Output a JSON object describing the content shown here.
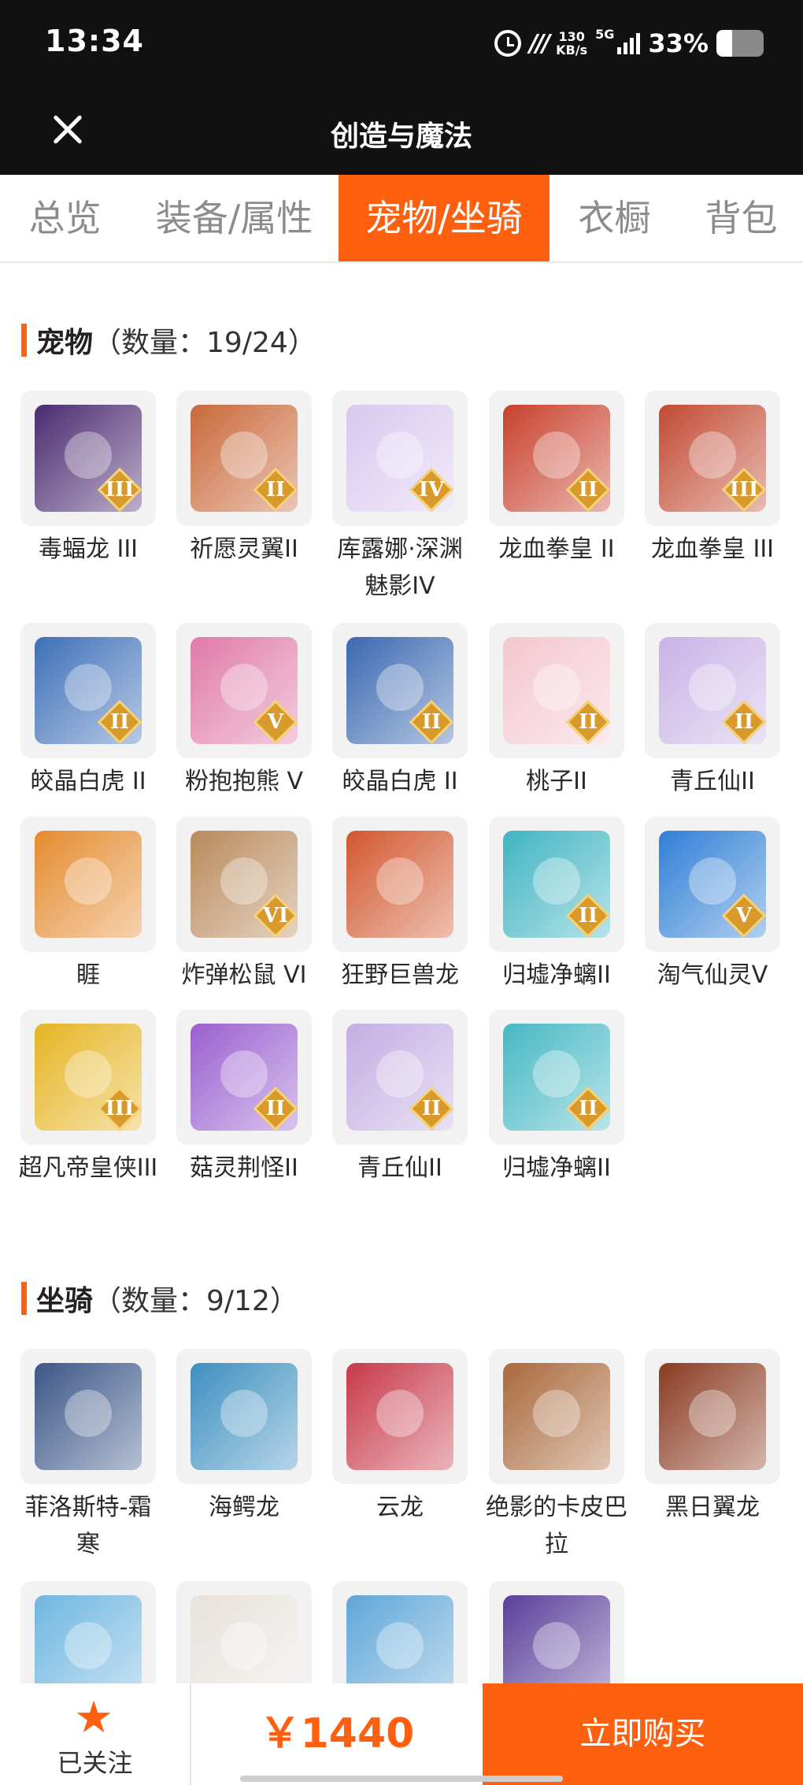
{
  "status_bar": {
    "time": "13:34",
    "network_speed_value": "130",
    "network_speed_unit": "KB/s",
    "network_type": "5G",
    "battery_percent": "33%",
    "battery_level": 0.33,
    "signal_bars": 4,
    "icons": [
      "alarm-icon",
      "mi-icon",
      "signal-icon",
      "battery-icon"
    ]
  },
  "nav": {
    "title": "创造与魔法",
    "close_icon": "close-icon"
  },
  "tabs": [
    {
      "label": "总览",
      "active": false
    },
    {
      "label": "装备/属性",
      "active": false
    },
    {
      "label": "宠物/坐骑",
      "active": true
    },
    {
      "label": "衣橱",
      "active": false
    },
    {
      "label": "背包",
      "active": false
    }
  ],
  "pets": {
    "title": "宠物",
    "count_label": "（数量：19/24）",
    "items": [
      {
        "name": "毒蝠龙 III",
        "tier": "III",
        "art": "#4b2a70"
      },
      {
        "name": "祈愿灵翼II",
        "tier": "II",
        "art": "#c9683a"
      },
      {
        "name": "库露娜·深渊魅影IV",
        "tier": "IV",
        "art": "#d9c8f0"
      },
      {
        "name": "龙血拳皇 II",
        "tier": "II",
        "art": "#c8402c"
      },
      {
        "name": "龙血拳皇 III",
        "tier": "III",
        "art": "#c24a33"
      },
      {
        "name": "皎晶白虎 II",
        "tier": "II",
        "art": "#3d6fb8"
      },
      {
        "name": "粉抱抱熊 V",
        "tier": "V",
        "art": "#e07aa8"
      },
      {
        "name": "皎晶白虎 II",
        "tier": "II",
        "art": "#3a68b0"
      },
      {
        "name": "桃子II",
        "tier": "II",
        "art": "#f4c6cf"
      },
      {
        "name": "青丘仙II",
        "tier": "II",
        "art": "#c9b3e6"
      },
      {
        "name": "睚",
        "tier": "",
        "art": "#e58a2e"
      },
      {
        "name": "炸弹松鼠 VI",
        "tier": "VI",
        "art": "#b98a5c"
      },
      {
        "name": "狂野巨兽龙",
        "tier": "",
        "art": "#d2572e"
      },
      {
        "name": "归墟净螭II",
        "tier": "II",
        "art": "#3fb4c2"
      },
      {
        "name": "淘气仙灵V",
        "tier": "V",
        "art": "#2f7fd6"
      },
      {
        "name": "超凡帝皇侠III",
        "tier": "III",
        "art": "#e6b422"
      },
      {
        "name": "菇灵荆怪II",
        "tier": "II",
        "art": "#9a5fd0"
      },
      {
        "name": "青丘仙II",
        "tier": "II",
        "art": "#c4aee3"
      },
      {
        "name": "归墟净螭II",
        "tier": "II",
        "art": "#46b8c4"
      }
    ]
  },
  "mounts": {
    "title": "坐骑",
    "count_label": "（数量：9/12）",
    "items": [
      {
        "name": "菲洛斯特-霜寒",
        "tier": "",
        "art": "#3b5687"
      },
      {
        "name": "海鳄龙",
        "tier": "",
        "art": "#3d8fc0"
      },
      {
        "name": "云龙",
        "tier": "",
        "art": "#c8394a"
      },
      {
        "name": "绝影的卡皮巴拉",
        "tier": "",
        "art": "#a9683a"
      },
      {
        "name": "黑日翼龙",
        "tier": "",
        "art": "#8a3b22"
      },
      {
        "name": "",
        "tier": "",
        "art": "#6fb6e0"
      },
      {
        "name": "",
        "tier": "",
        "art": "#e8e2dc"
      },
      {
        "name": "",
        "tier": "",
        "art": "#5fa6d8"
      },
      {
        "name": "",
        "tier": "",
        "art": "#5a3f9a"
      }
    ]
  },
  "bottom": {
    "follow_label": "已关注",
    "star_icon": "star-icon",
    "price": "￥1440",
    "buy_label": "立即购买"
  },
  "colors": {
    "accent": "#ff6010",
    "header": "#111111",
    "tab_inactive": "#8c8c8c",
    "thumb_bg": "#f2f2f2"
  }
}
